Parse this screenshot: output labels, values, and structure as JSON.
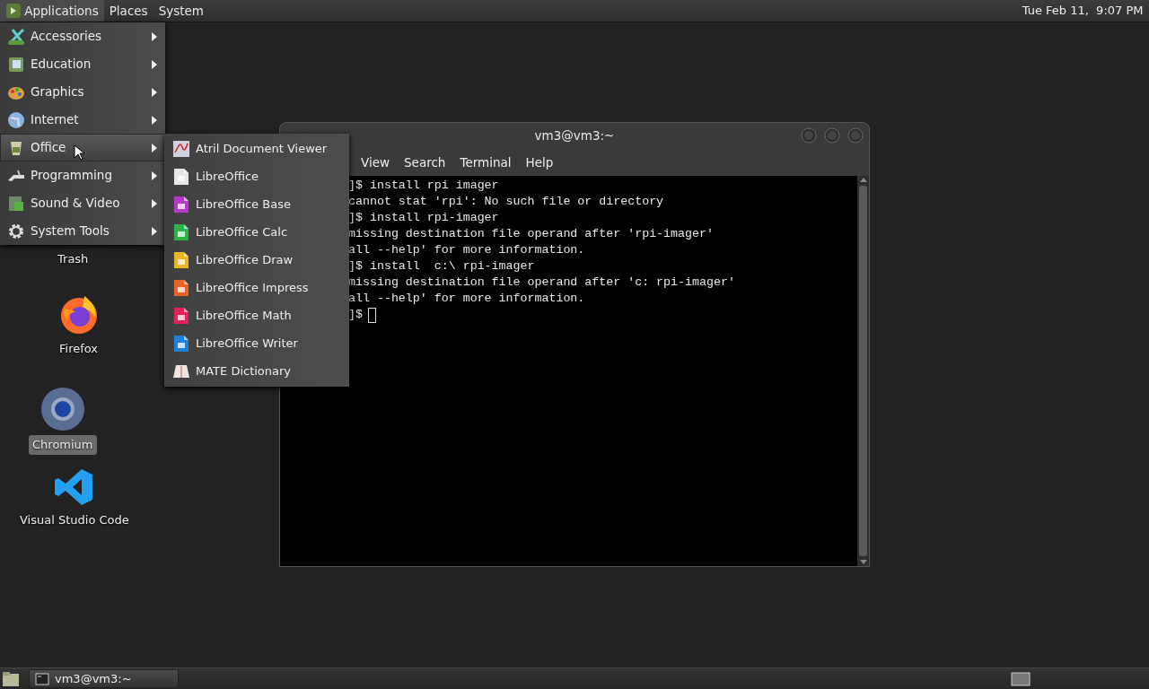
{
  "top_panel": {
    "menus": [
      {
        "label": "Applications",
        "selected": true
      },
      {
        "label": "Places",
        "selected": false
      },
      {
        "label": "System",
        "selected": false
      }
    ],
    "clock": "Tue Feb 11,  9:07 PM"
  },
  "applications_menu": {
    "items": [
      {
        "label": "Accessories",
        "selected": false
      },
      {
        "label": "Education",
        "selected": false
      },
      {
        "label": "Graphics",
        "selected": false
      },
      {
        "label": "Internet",
        "selected": false
      },
      {
        "label": "Office",
        "selected": true
      },
      {
        "label": "Programming",
        "selected": false
      },
      {
        "label": "Sound & Video",
        "selected": false
      },
      {
        "label": "System Tools",
        "selected": false
      }
    ]
  },
  "office_submenu": {
    "items": [
      {
        "label": "Atril Document Viewer",
        "color": "#d0d0e0"
      },
      {
        "label": "LibreOffice",
        "color": "#e6e6e6"
      },
      {
        "label": "LibreOffice Base",
        "color": "#b43bc8"
      },
      {
        "label": "LibreOffice Calc",
        "color": "#2fb24a"
      },
      {
        "label": "LibreOffice Draw",
        "color": "#e8b528"
      },
      {
        "label": "LibreOffice Impress",
        "color": "#e8622a"
      },
      {
        "label": "LibreOffice Math",
        "color": "#e0245a"
      },
      {
        "label": "LibreOffice Writer",
        "color": "#1f7fd6"
      },
      {
        "label": "MATE Dictionary",
        "color": "#efe6e0"
      }
    ]
  },
  "desktop_icons": [
    {
      "label": "Trash",
      "selected": false
    },
    {
      "label": "Firefox",
      "selected": false
    },
    {
      "label": "Chromium",
      "selected": true
    },
    {
      "label": "Visual Studio Code",
      "selected": false
    }
  ],
  "terminal": {
    "title": "vm3@vm3:~",
    "menus": [
      "View",
      "Search",
      "Terminal",
      "Help"
    ],
    "lines": [
      "]$ install rpi imager",
      "cannot stat 'rpi': No such file or directory",
      "]$ install rpi-imager",
      "missing destination file operand after 'rpi-imager'",
      "all --help' for more information.",
      "]$ install  c:\\ rpi-imager",
      "missing destination file operand after 'c: rpi-imager'",
      "all --help' for more information.",
      "]$"
    ]
  },
  "taskbar": {
    "windows": [
      {
        "label": "vm3@vm3:~",
        "selected": false
      }
    ]
  }
}
